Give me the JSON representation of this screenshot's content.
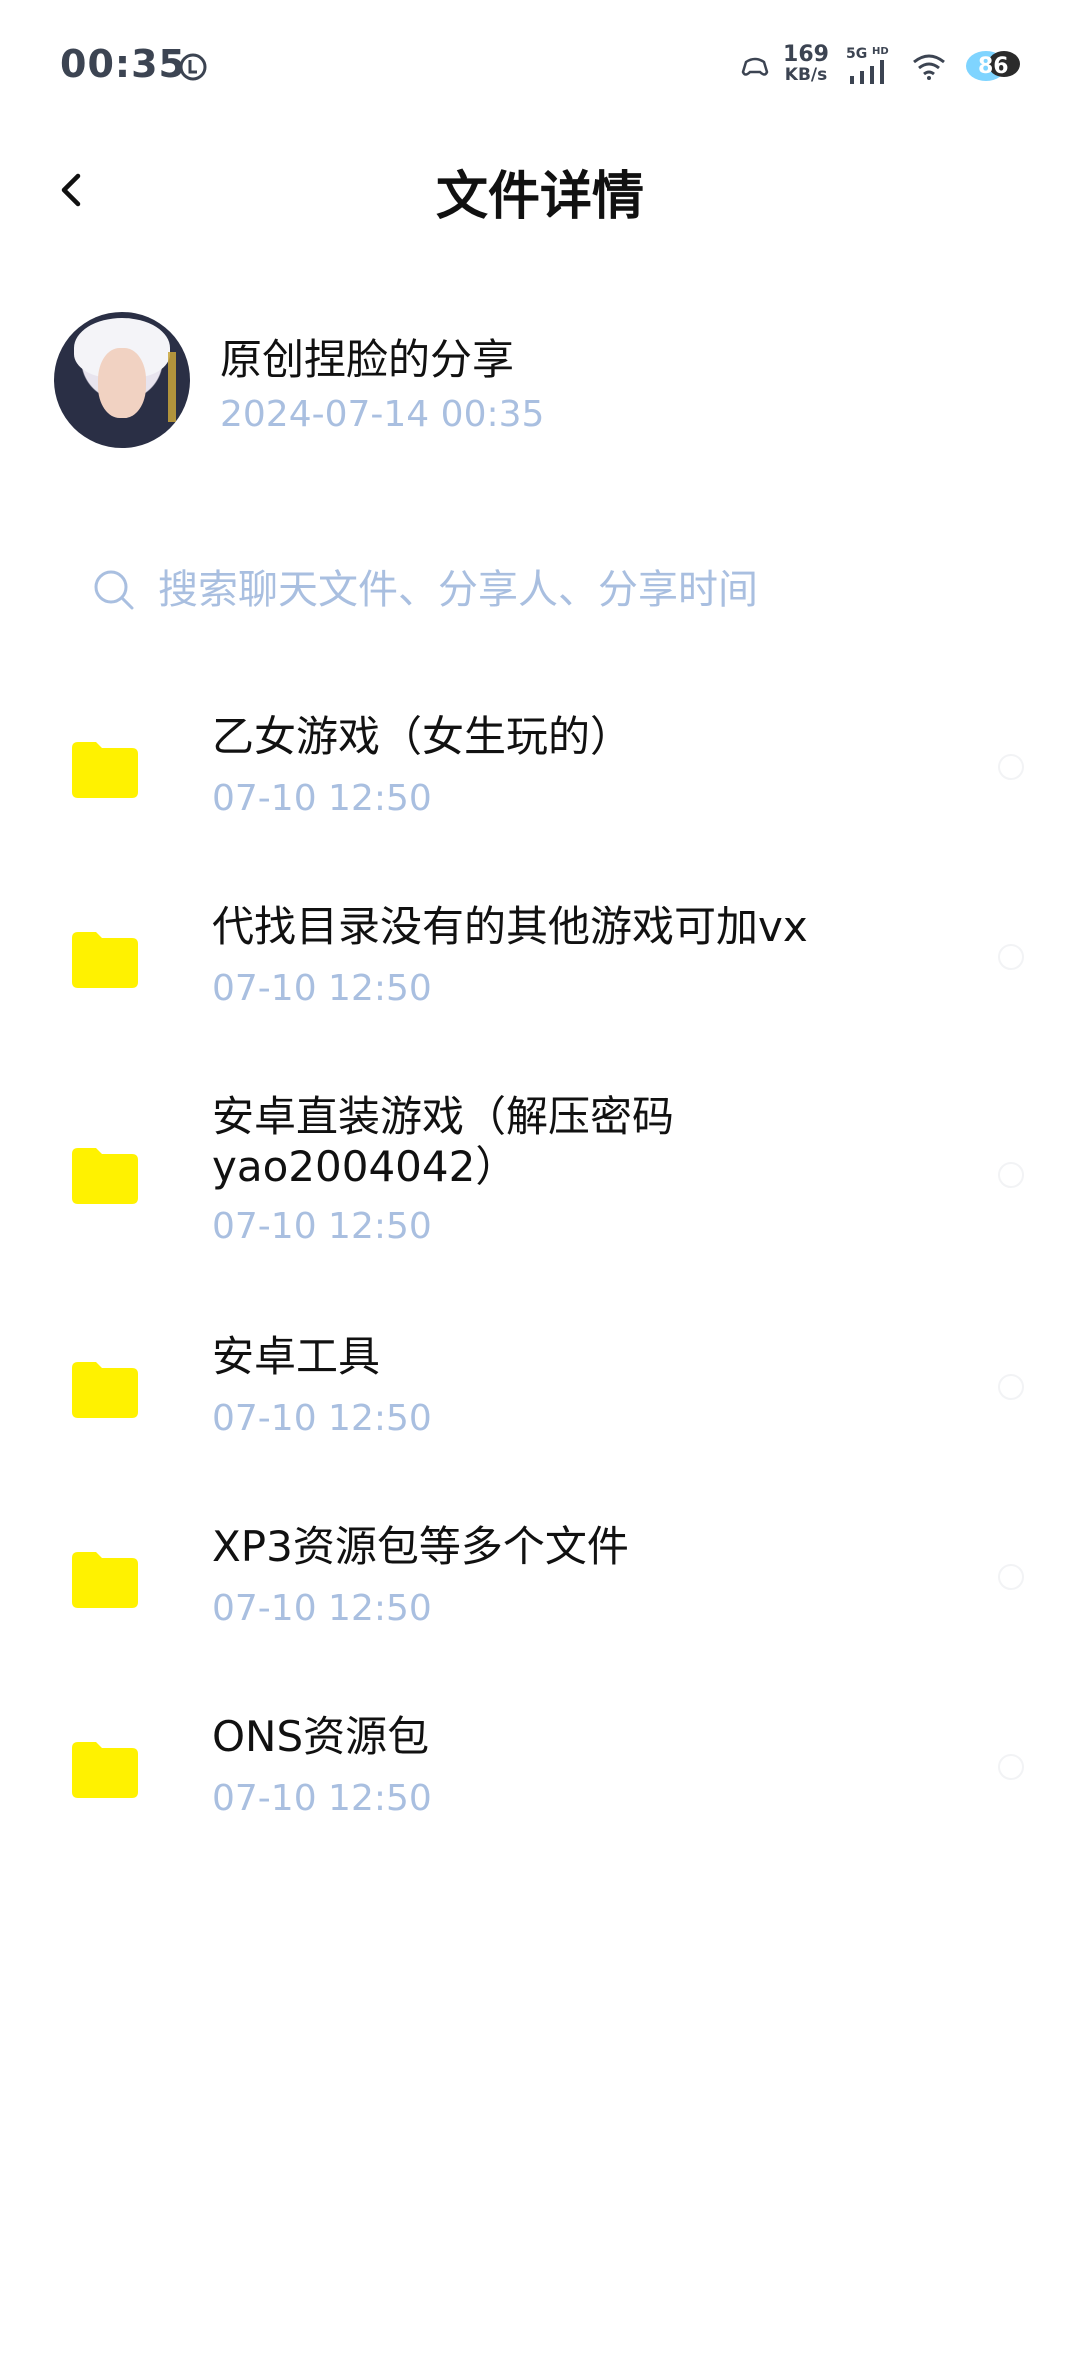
{
  "status_bar": {
    "time": "00:35",
    "speed_value": "169",
    "speed_unit": "KB/s",
    "network_5g": "5G",
    "hd_label": "HD",
    "battery": "86"
  },
  "header": {
    "title": "文件详情"
  },
  "sharer": {
    "name": "原创捏脸的分享",
    "time": "2024-07-14  00:35"
  },
  "search": {
    "placeholder": "搜索聊天文件、分享人、分享时间"
  },
  "colors": {
    "folder": "#fff200",
    "muted_text": "#a9bfe0",
    "primary_text": "#111111"
  },
  "files": [
    {
      "name": "乙女游戏（女生玩的）",
      "time": "07-10  12:50"
    },
    {
      "name": "代找目录没有的其他游戏可加vx",
      "time": "07-10  12:50"
    },
    {
      "name": "安卓直装游戏（解压密码yao2004042）",
      "time": "07-10  12:50"
    },
    {
      "name": "安卓工具",
      "time": "07-10  12:50"
    },
    {
      "name": "XP3资源包等多个文件",
      "time": "07-10  12:50"
    },
    {
      "name": "ONS资源包",
      "time": "07-10  12:50"
    }
  ]
}
